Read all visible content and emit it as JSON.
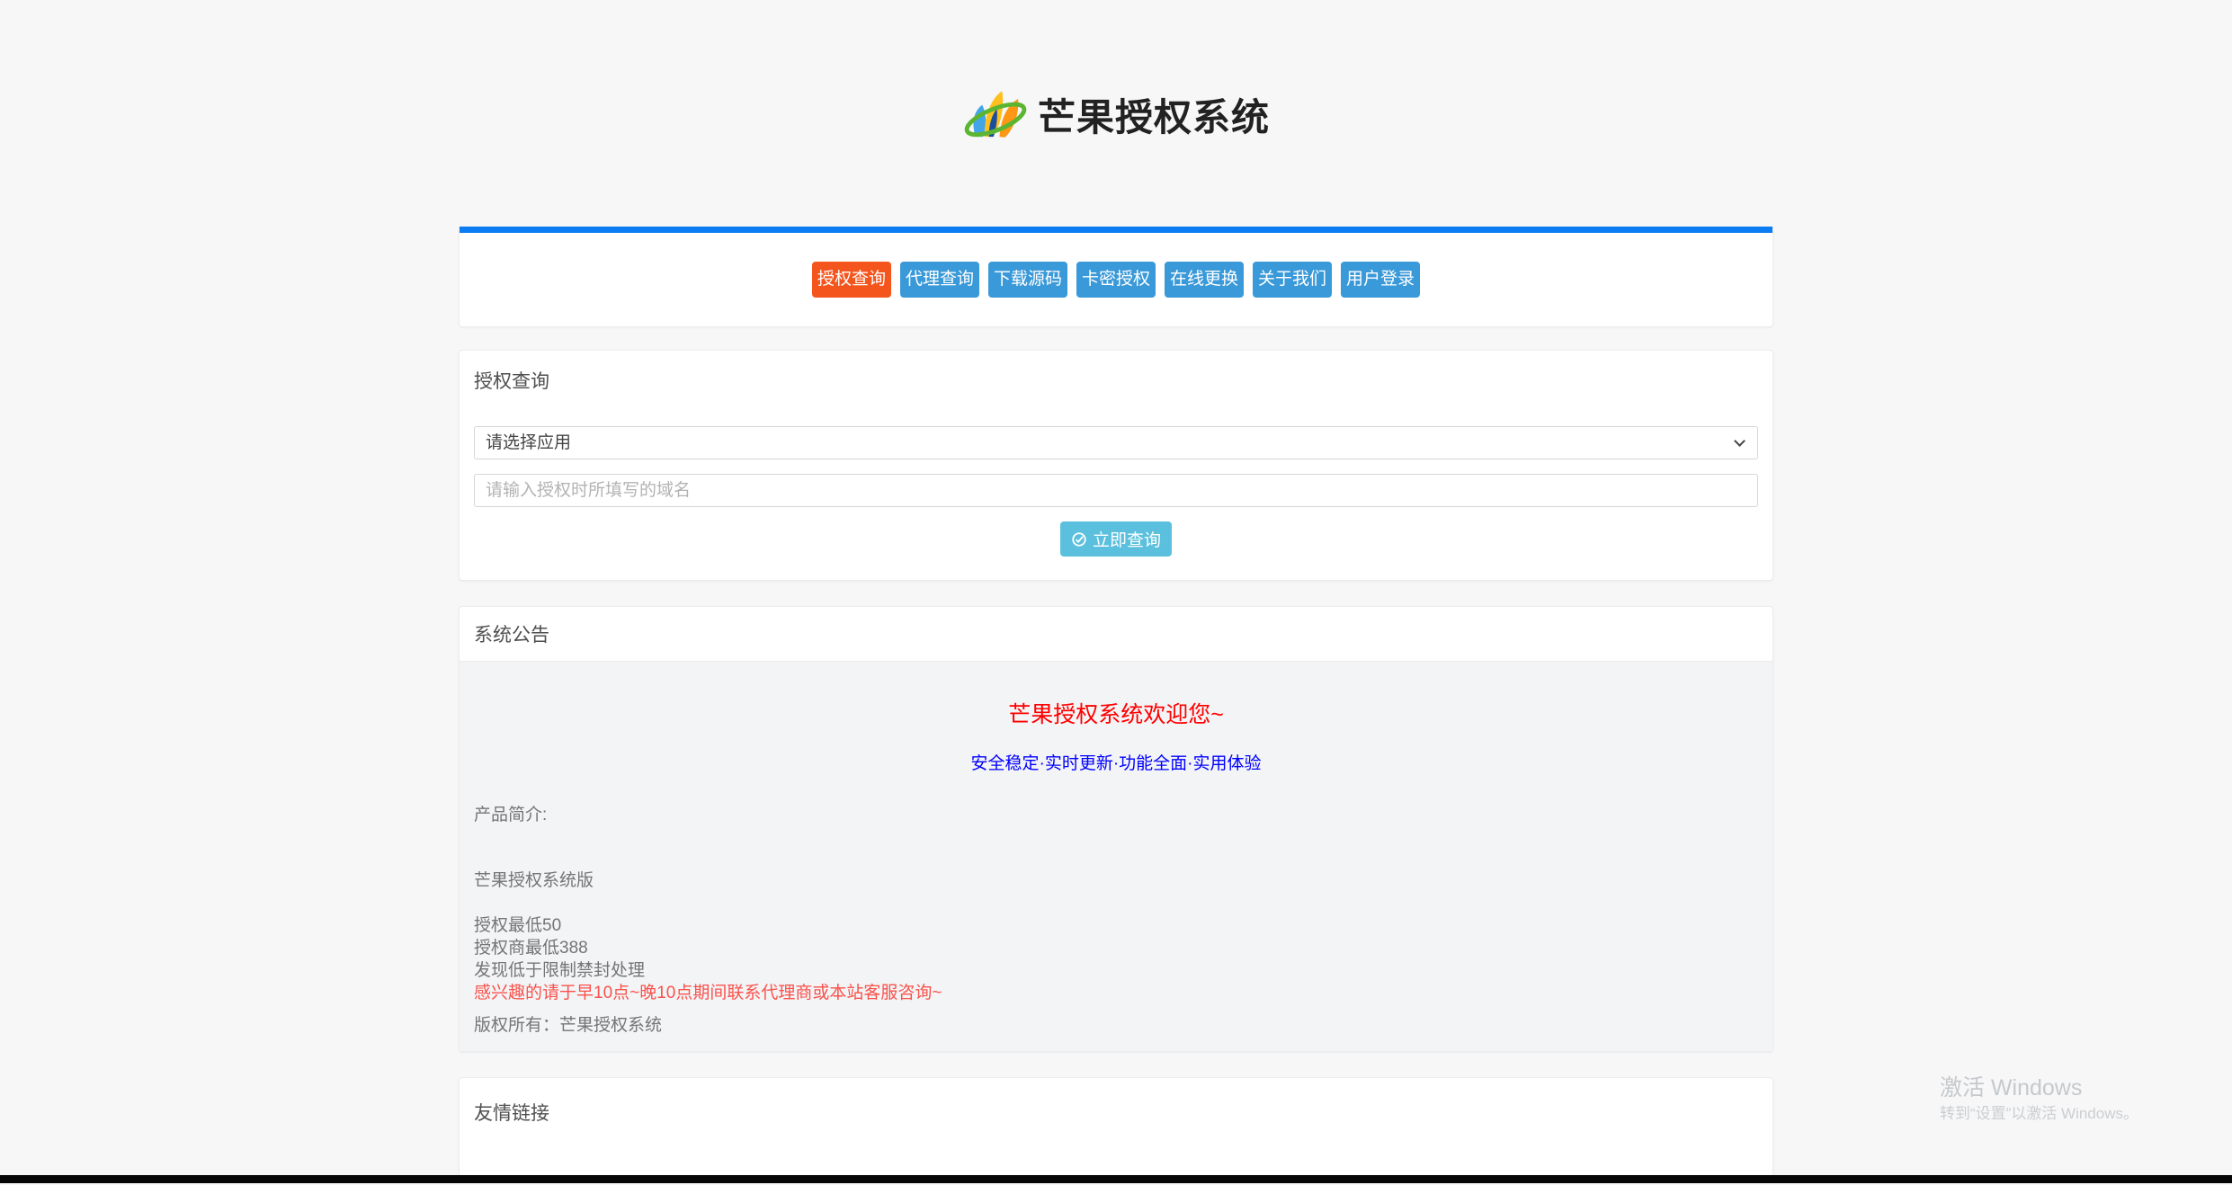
{
  "site": {
    "title": "芒果授权系统"
  },
  "colors": {
    "page_background": "#f7f7f8",
    "accent_bar_blue": "#0c7cf2",
    "nav_button_blue": "#3a99d8",
    "nav_button_active_orange": "#f4551d",
    "submit_button_cyan": "#5bc0de",
    "headline_red": "#fe0000",
    "tagline_blue": "#0000fe",
    "contact_red": "#fa524c",
    "announce_body_gray": "#f3f4f6"
  },
  "nav": {
    "items": [
      {
        "label": "授权查询",
        "active": true
      },
      {
        "label": "代理查询",
        "active": false
      },
      {
        "label": "下载源码",
        "active": false
      },
      {
        "label": "卡密授权",
        "active": false
      },
      {
        "label": "在线更换",
        "active": false
      },
      {
        "label": "关于我们",
        "active": false
      },
      {
        "label": "用户登录",
        "active": false
      }
    ]
  },
  "query_card": {
    "title": "授权查询",
    "select_placeholder": "请选择应用",
    "domain_placeholder": "请输入授权时所填写的域名",
    "submit_label": "立即查询",
    "submit_icon": "check-circle-icon"
  },
  "announcement_card": {
    "title": "系统公告",
    "headline": "芒果授权系统欢迎您~",
    "tagline": "安全稳定·实时更新·功能全面·实用体验",
    "intro_label": "产品简介:",
    "product_name": "芒果授权系统版",
    "line_auth_min": "授权最低50",
    "line_agent_min": "授权商最低388",
    "line_warning": "发现低于限制禁封处理",
    "line_contact": "感兴趣的请于早10点~晚10点期间联系代理商或本站客服咨询~",
    "copyright": "版权所有：芒果授权系统"
  },
  "links_card": {
    "title": "友情链接"
  },
  "watermark": {
    "line1": "激活 Windows",
    "line2": "转到“设置”以激活 Windows。"
  }
}
